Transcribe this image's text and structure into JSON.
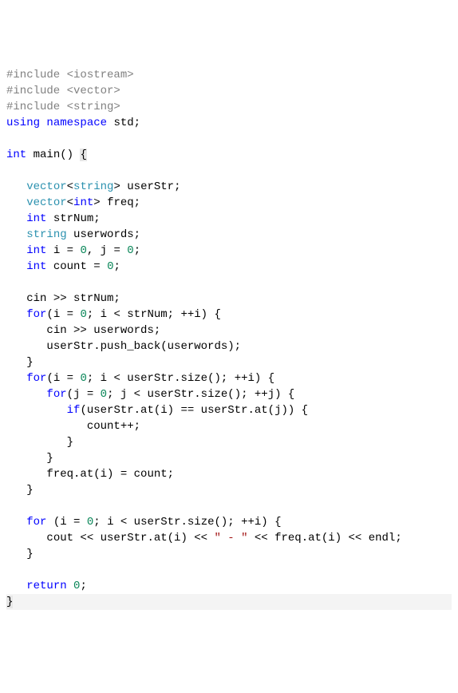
{
  "code": {
    "lines": [
      {
        "indent": 0,
        "fragments": [
          {
            "t": "#include <iostream>",
            "c": "preproc"
          }
        ]
      },
      {
        "indent": 0,
        "fragments": [
          {
            "t": "#include <vector>",
            "c": "preproc"
          }
        ]
      },
      {
        "indent": 0,
        "fragments": [
          {
            "t": "#include <string>",
            "c": "preproc"
          }
        ]
      },
      {
        "indent": 0,
        "fragments": [
          {
            "t": "using",
            "c": "keyword"
          },
          {
            "t": " "
          },
          {
            "t": "namespace",
            "c": "keyword"
          },
          {
            "t": " std;"
          }
        ]
      },
      {
        "indent": 0,
        "fragments": []
      },
      {
        "indent": 0,
        "fragments": [
          {
            "t": "int",
            "c": "keyword"
          },
          {
            "t": " main() "
          },
          {
            "t": "{",
            "c": "brace-hl"
          }
        ]
      },
      {
        "indent": 0,
        "fragments": []
      },
      {
        "indent": 1,
        "fragments": [
          {
            "t": "vector",
            "c": "type"
          },
          {
            "t": "<"
          },
          {
            "t": "string",
            "c": "type"
          },
          {
            "t": "> userStr;"
          }
        ]
      },
      {
        "indent": 1,
        "fragments": [
          {
            "t": "vector",
            "c": "type"
          },
          {
            "t": "<"
          },
          {
            "t": "int",
            "c": "keyword"
          },
          {
            "t": "> freq;"
          }
        ]
      },
      {
        "indent": 1,
        "fragments": [
          {
            "t": "int",
            "c": "keyword"
          },
          {
            "t": " strNum;"
          }
        ]
      },
      {
        "indent": 1,
        "fragments": [
          {
            "t": "string",
            "c": "type"
          },
          {
            "t": " userwords;"
          }
        ]
      },
      {
        "indent": 1,
        "fragments": [
          {
            "t": "int",
            "c": "keyword"
          },
          {
            "t": " i = "
          },
          {
            "t": "0",
            "c": "num"
          },
          {
            "t": ", j = "
          },
          {
            "t": "0",
            "c": "num"
          },
          {
            "t": ";"
          }
        ]
      },
      {
        "indent": 1,
        "fragments": [
          {
            "t": "int",
            "c": "keyword"
          },
          {
            "t": " count = "
          },
          {
            "t": "0",
            "c": "num"
          },
          {
            "t": ";"
          }
        ]
      },
      {
        "indent": 0,
        "fragments": []
      },
      {
        "indent": 1,
        "fragments": [
          {
            "t": "cin >> strNum;"
          }
        ]
      },
      {
        "indent": 1,
        "fragments": [
          {
            "t": "for",
            "c": "keyword"
          },
          {
            "t": "(i = "
          },
          {
            "t": "0",
            "c": "num"
          },
          {
            "t": "; i < strNum; ++i) {"
          }
        ]
      },
      {
        "indent": 2,
        "fragments": [
          {
            "t": "cin >> userwords;"
          }
        ]
      },
      {
        "indent": 2,
        "fragments": [
          {
            "t": "userStr.push_back(userwords);"
          }
        ]
      },
      {
        "indent": 1,
        "fragments": [
          {
            "t": "}"
          }
        ]
      },
      {
        "indent": 1,
        "fragments": [
          {
            "t": "for",
            "c": "keyword"
          },
          {
            "t": "(i = "
          },
          {
            "t": "0",
            "c": "num"
          },
          {
            "t": "; i < userStr.size(); ++i) {"
          }
        ]
      },
      {
        "indent": 2,
        "fragments": [
          {
            "t": "for",
            "c": "keyword"
          },
          {
            "t": "(j = "
          },
          {
            "t": "0",
            "c": "num"
          },
          {
            "t": "; j < userStr.size(); ++j) {"
          }
        ]
      },
      {
        "indent": 3,
        "fragments": [
          {
            "t": "if",
            "c": "keyword"
          },
          {
            "t": "(userStr.at(i) == userStr.at(j)) {"
          }
        ]
      },
      {
        "indent": 4,
        "fragments": [
          {
            "t": "count++;"
          }
        ]
      },
      {
        "indent": 3,
        "fragments": [
          {
            "t": "}"
          }
        ]
      },
      {
        "indent": 2,
        "fragments": [
          {
            "t": "}"
          }
        ]
      },
      {
        "indent": 2,
        "fragments": [
          {
            "t": "freq.at(i) = count;"
          }
        ]
      },
      {
        "indent": 1,
        "fragments": [
          {
            "t": "}"
          }
        ]
      },
      {
        "indent": 0,
        "fragments": []
      },
      {
        "indent": 1,
        "fragments": [
          {
            "t": "for",
            "c": "keyword"
          },
          {
            "t": " (i = "
          },
          {
            "t": "0",
            "c": "num"
          },
          {
            "t": "; i < userStr.size(); ++i) {"
          }
        ]
      },
      {
        "indent": 2,
        "fragments": [
          {
            "t": "cout << userStr.at(i) << "
          },
          {
            "t": "\" - \"",
            "c": "str"
          },
          {
            "t": " << freq.at(i) << endl;"
          }
        ]
      },
      {
        "indent": 1,
        "fragments": [
          {
            "t": "}"
          }
        ]
      },
      {
        "indent": 0,
        "fragments": []
      },
      {
        "indent": 1,
        "fragments": [
          {
            "t": "return",
            "c": "keyword"
          },
          {
            "t": " "
          },
          {
            "t": "0",
            "c": "num"
          },
          {
            "t": ";"
          }
        ]
      },
      {
        "indent": 0,
        "fragments": [
          {
            "t": "}",
            "c": "brace-hl"
          }
        ],
        "hl": true
      }
    ]
  },
  "indent_unit": "   "
}
